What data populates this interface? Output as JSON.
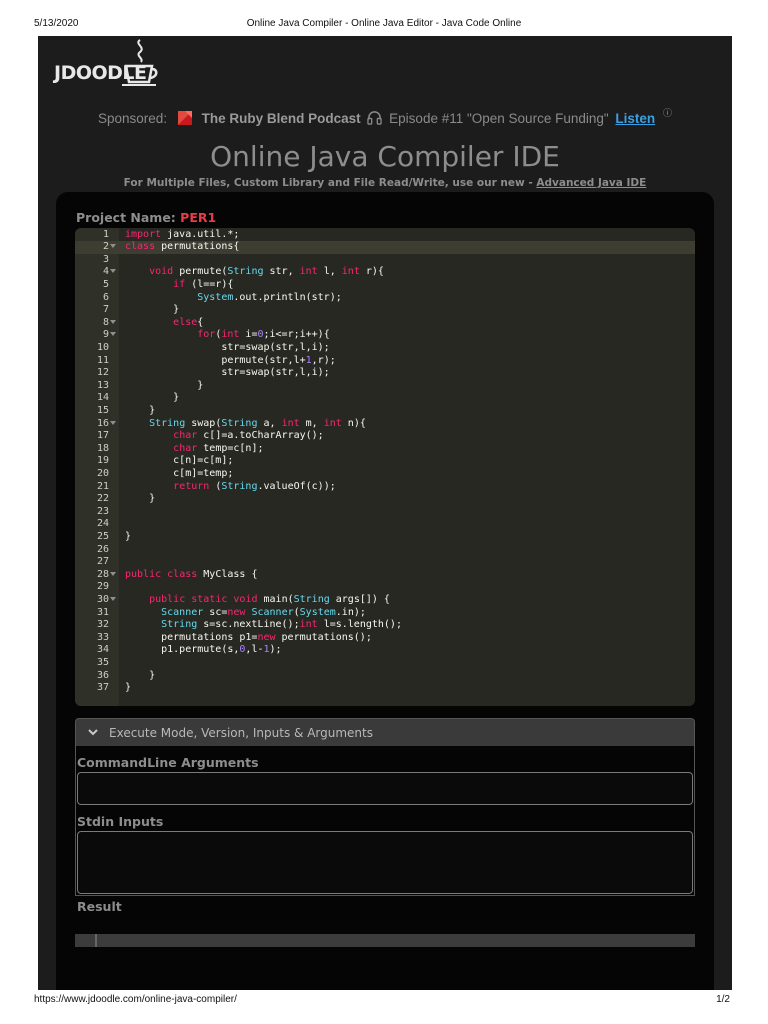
{
  "print_header": {
    "date": "5/13/2020",
    "title": "Online Java Compiler - Online Java Editor - Java Code Online"
  },
  "print_footer": {
    "url": "https://www.jdoodle.com/online-java-compiler/",
    "page": "1/2"
  },
  "logo": {
    "text": "JDOODLE",
    "icon": "coffee-cup-icon"
  },
  "sponsor": {
    "label": "Sponsored:",
    "podcast": "The Ruby Blend Podcast",
    "episode": "Episode #11 \"Open Source Funding\"",
    "listen": "Listen",
    "info": "ⓘ",
    "icons": [
      "ruby-gem-icon",
      "headphones-icon",
      "info-icon"
    ]
  },
  "main": {
    "title": "Online Java Compiler IDE",
    "subtitle_prefix": "For Multiple Files, Custom Library and File Read/Write, use our new - ",
    "subtitle_link": "Advanced Java IDE"
  },
  "project": {
    "label": "Project Name: ",
    "name": "PER1"
  },
  "editor": {
    "active_line": 2,
    "lines": [
      "import java.util.*;",
      "class permutations{",
      "",
      "    void permute(String str, int l, int r){",
      "        if (l==r){",
      "            System.out.println(str);",
      "        }",
      "        else{",
      "            for(int i=0;i<=r;i++){",
      "                str=swap(str,l,i);",
      "                permute(str,l+1,r);",
      "                str=swap(str,l,i);",
      "            }",
      "        }",
      "    }",
      "    String swap(String a, int m, int n){",
      "        char c[]=a.toCharArray();",
      "        char temp=c[n];",
      "        c[n]=c[m];",
      "        c[m]=temp;",
      "        return (String.valueOf(c));",
      "    }",
      "",
      "",
      "}",
      "",
      "",
      "public class MyClass {",
      "",
      "    public static void main(String args[]) {",
      "      Scanner sc=new Scanner(System.in);",
      "      String s=sc.nextLine();int l=s.length();",
      "      permutations p1=new permutations();",
      "      p1.permute(s,0,l-1);",
      "",
      "    }",
      "}"
    ],
    "fold_lines": [
      2,
      4,
      8,
      9,
      16,
      28,
      30
    ]
  },
  "exec": {
    "header": "Execute Mode, Version, Inputs & Arguments",
    "args_label": "CommandLine Arguments",
    "args_value": "",
    "stdin_label": "Stdin Inputs",
    "stdin_value": ""
  },
  "result": {
    "label": "Result"
  },
  "colors": {
    "background": "#1c1c1c",
    "editor_bg": "#272822",
    "keyword": "#f92672",
    "type": "#66d9ef",
    "number": "#ae81ff",
    "project_name": "#e83c48",
    "link": "#3aa0e6"
  }
}
